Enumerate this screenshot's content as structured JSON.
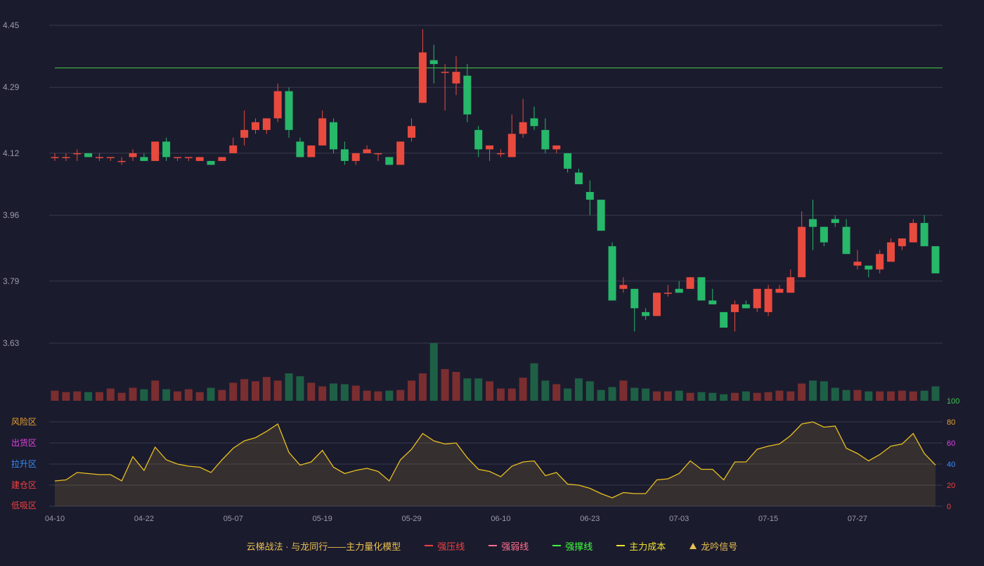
{
  "chart_data": [
    {
      "type": "candlestick",
      "x_tick_labels": [
        "04-10",
        "04-22",
        "05-07",
        "05-19",
        "05-29",
        "06-10",
        "06-23",
        "07-03",
        "07-15",
        "07-27"
      ],
      "y_ticks": [
        4.45,
        4.29,
        4.12,
        3.96,
        3.79,
        3.63
      ],
      "ylim": [
        3.63,
        4.45
      ],
      "grid": true,
      "resistance_line": 4.34,
      "candles": [
        [
          4.11,
          4.11,
          4.1,
          4.12
        ],
        [
          4.11,
          4.11,
          4.1,
          4.12
        ],
        [
          4.12,
          4.12,
          4.1,
          4.13
        ],
        [
          4.12,
          4.11,
          4.11,
          4.12
        ],
        [
          4.11,
          4.11,
          4.1,
          4.12
        ],
        [
          4.11,
          4.11,
          4.1,
          4.11
        ],
        [
          4.1,
          4.1,
          4.09,
          4.11
        ],
        [
          4.11,
          4.12,
          4.1,
          4.13
        ],
        [
          4.11,
          4.1,
          4.1,
          4.12
        ],
        [
          4.1,
          4.15,
          4.1,
          4.15
        ],
        [
          4.15,
          4.11,
          4.1,
          4.16
        ],
        [
          4.11,
          4.11,
          4.1,
          4.11
        ],
        [
          4.11,
          4.11,
          4.1,
          4.11
        ],
        [
          4.1,
          4.11,
          4.1,
          4.11
        ],
        [
          4.1,
          4.09,
          4.09,
          4.1
        ],
        [
          4.1,
          4.11,
          4.1,
          4.11
        ],
        [
          4.12,
          4.14,
          4.12,
          4.16
        ],
        [
          4.16,
          4.18,
          4.14,
          4.23
        ],
        [
          4.18,
          4.2,
          4.17,
          4.21
        ],
        [
          4.18,
          4.21,
          4.17,
          4.21
        ],
        [
          4.21,
          4.28,
          4.2,
          4.3
        ],
        [
          4.28,
          4.18,
          4.16,
          4.29
        ],
        [
          4.15,
          4.11,
          4.11,
          4.16
        ],
        [
          4.11,
          4.14,
          4.11,
          4.14
        ],
        [
          4.14,
          4.21,
          4.14,
          4.23
        ],
        [
          4.2,
          4.13,
          4.12,
          4.21
        ],
        [
          4.13,
          4.1,
          4.09,
          4.15
        ],
        [
          4.1,
          4.12,
          4.09,
          4.12
        ],
        [
          4.12,
          4.13,
          4.12,
          4.14
        ],
        [
          4.12,
          4.12,
          4.1,
          4.12
        ],
        [
          4.11,
          4.09,
          4.09,
          4.11
        ],
        [
          4.09,
          4.15,
          4.09,
          4.15
        ],
        [
          4.16,
          4.19,
          4.15,
          4.21
        ],
        [
          4.25,
          4.38,
          4.25,
          4.44
        ],
        [
          4.36,
          4.35,
          4.3,
          4.4
        ],
        [
          4.33,
          4.33,
          4.23,
          4.35
        ],
        [
          4.3,
          4.33,
          4.27,
          4.37
        ],
        [
          4.32,
          4.22,
          4.2,
          4.35
        ],
        [
          4.18,
          4.13,
          4.11,
          4.19
        ],
        [
          4.13,
          4.14,
          4.1,
          4.14
        ],
        [
          4.12,
          4.12,
          4.11,
          4.13
        ],
        [
          4.11,
          4.17,
          4.11,
          4.22
        ],
        [
          4.17,
          4.2,
          4.16,
          4.26
        ],
        [
          4.21,
          4.19,
          4.18,
          4.24
        ],
        [
          4.18,
          4.13,
          4.12,
          4.21
        ],
        [
          4.13,
          4.14,
          4.12,
          4.14
        ],
        [
          4.12,
          4.08,
          4.07,
          4.12
        ],
        [
          4.07,
          4.04,
          4.04,
          4.08
        ],
        [
          4.02,
          4.0,
          3.96,
          4.05
        ],
        [
          4.0,
          3.92,
          3.92,
          4.0
        ],
        [
          3.88,
          3.74,
          3.74,
          3.89
        ],
        [
          3.77,
          3.78,
          3.76,
          3.8
        ],
        [
          3.77,
          3.72,
          3.66,
          3.77
        ],
        [
          3.71,
          3.7,
          3.69,
          3.72
        ],
        [
          3.7,
          3.76,
          3.7,
          3.76
        ],
        [
          3.76,
          3.76,
          3.75,
          3.78
        ],
        [
          3.77,
          3.76,
          3.76,
          3.79
        ],
        [
          3.77,
          3.8,
          3.77,
          3.8
        ],
        [
          3.8,
          3.74,
          3.74,
          3.8
        ],
        [
          3.74,
          3.73,
          3.73,
          3.77
        ],
        [
          3.71,
          3.67,
          3.67,
          3.71
        ],
        [
          3.71,
          3.73,
          3.66,
          3.74
        ],
        [
          3.73,
          3.72,
          3.72,
          3.74
        ],
        [
          3.72,
          3.77,
          3.71,
          3.77
        ],
        [
          3.71,
          3.77,
          3.7,
          3.78
        ],
        [
          3.76,
          3.77,
          3.76,
          3.78
        ],
        [
          3.76,
          3.8,
          3.76,
          3.82
        ],
        [
          3.8,
          3.93,
          3.8,
          3.97
        ],
        [
          3.95,
          3.93,
          3.87,
          4.0
        ],
        [
          3.93,
          3.89,
          3.88,
          3.93
        ],
        [
          3.95,
          3.94,
          3.93,
          3.96
        ],
        [
          3.93,
          3.86,
          3.86,
          3.95
        ],
        [
          3.83,
          3.84,
          3.82,
          3.87
        ],
        [
          3.83,
          3.82,
          3.8,
          3.83
        ],
        [
          3.82,
          3.86,
          3.81,
          3.87
        ],
        [
          3.84,
          3.89,
          3.84,
          3.9
        ],
        [
          3.88,
          3.9,
          3.87,
          3.9
        ],
        [
          3.89,
          3.94,
          3.89,
          3.95
        ],
        [
          3.94,
          3.88,
          3.88,
          3.96
        ],
        [
          3.88,
          3.81,
          3.81,
          3.88
        ]
      ],
      "volume": [
        14,
        12,
        13,
        12,
        12,
        17,
        11,
        18,
        16,
        28,
        16,
        13,
        16,
        12,
        18,
        15,
        25,
        30,
        27,
        33,
        28,
        38,
        34,
        25,
        20,
        24,
        23,
        21,
        14,
        13,
        14,
        15,
        28,
        38,
        80,
        44,
        40,
        31,
        31,
        27,
        17,
        17,
        32,
        52,
        28,
        23,
        17,
        31,
        27,
        15,
        19,
        28,
        18,
        17,
        13,
        13,
        14,
        11,
        12,
        11,
        9,
        11,
        13,
        11,
        12,
        14,
        13,
        24,
        28,
        27,
        18,
        15,
        15,
        13,
        13,
        13,
        14,
        13,
        14,
        20
      ]
    },
    {
      "type": "area",
      "left_labels": [
        "风险区",
        "出货区",
        "拉升区",
        "建仓区",
        "低吸区"
      ],
      "left_label_colors": [
        "#e8a030",
        "#e040e0",
        "#3090ff",
        "#f04040",
        "#f04040"
      ],
      "right_ticks": [
        100,
        80,
        60,
        40,
        20,
        0
      ],
      "right_tick_colors": [
        "#3cc850",
        "#e8a030",
        "#e040e0",
        "#3090ff",
        "#f04040",
        "#f04040"
      ],
      "ylim": [
        0,
        100
      ],
      "line_color": "#e8c020",
      "values": [
        24,
        25,
        32,
        31,
        30,
        30,
        24,
        47,
        34,
        56,
        44,
        40,
        38,
        37,
        32,
        44,
        55,
        62,
        65,
        71,
        78,
        51,
        39,
        42,
        53,
        37,
        31,
        34,
        36,
        33,
        24,
        44,
        54,
        69,
        62,
        59,
        60,
        46,
        35,
        33,
        28,
        38,
        42,
        43,
        29,
        32,
        21,
        20,
        17,
        12,
        8,
        13,
        12,
        12,
        25,
        26,
        31,
        43,
        35,
        35,
        25,
        42,
        42,
        54,
        57,
        59,
        67,
        78,
        80,
        75,
        76,
        55,
        50,
        43,
        49,
        57,
        59,
        69,
        50,
        39
      ]
    }
  ],
  "legend": {
    "title": "云梯战法 · 与龙同行——主力量化模型",
    "items": [
      {
        "label": "强压线",
        "color": "#f04040",
        "style": "solid"
      },
      {
        "label": "强弱线",
        "color": "#ff7090",
        "style": "dash"
      },
      {
        "label": "强撑线",
        "color": "#40ff40",
        "style": "solid"
      },
      {
        "label": "主力成本",
        "color": "#f0e030",
        "style": "dash"
      },
      {
        "label": "龙吟信号",
        "color": "#e8c050",
        "style": "triangle"
      }
    ]
  },
  "colors": {
    "up": "#e84a3e",
    "down": "#27b86a",
    "vol_up": "#7a2e30",
    "vol_down": "#1e6045",
    "grid": "#3a3a4e",
    "axis_text": "#9a9aa8",
    "resistance": "#40d040"
  }
}
